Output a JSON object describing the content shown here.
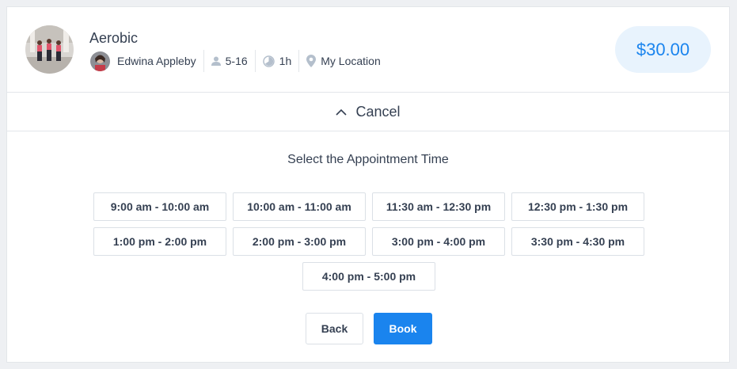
{
  "service": {
    "title": "Aerobic",
    "image_icon": "service-photo-icon",
    "employee_name": "Edwina Appleby",
    "capacity": "5-16",
    "duration": "1h",
    "location": "My Location",
    "price": "$30.00"
  },
  "cancel_label": "Cancel",
  "select_label": "Select the Appointment Time",
  "slots": [
    "9:00 am - 10:00 am",
    "10:00 am - 11:00 am",
    "11:30 am - 12:30 pm",
    "12:30 pm - 1:30 pm",
    "1:00 pm - 2:00 pm",
    "2:00 pm - 3:00 pm",
    "3:00 pm - 4:00 pm",
    "3:30 pm - 4:30 pm",
    "4:00 pm - 5:00 pm"
  ],
  "buttons": {
    "back": "Back",
    "book": "Book"
  },
  "colors": {
    "accent": "#1a84ee",
    "price_bg": "#e8f3fd",
    "text": "#354052",
    "border": "#e3e6ea"
  }
}
